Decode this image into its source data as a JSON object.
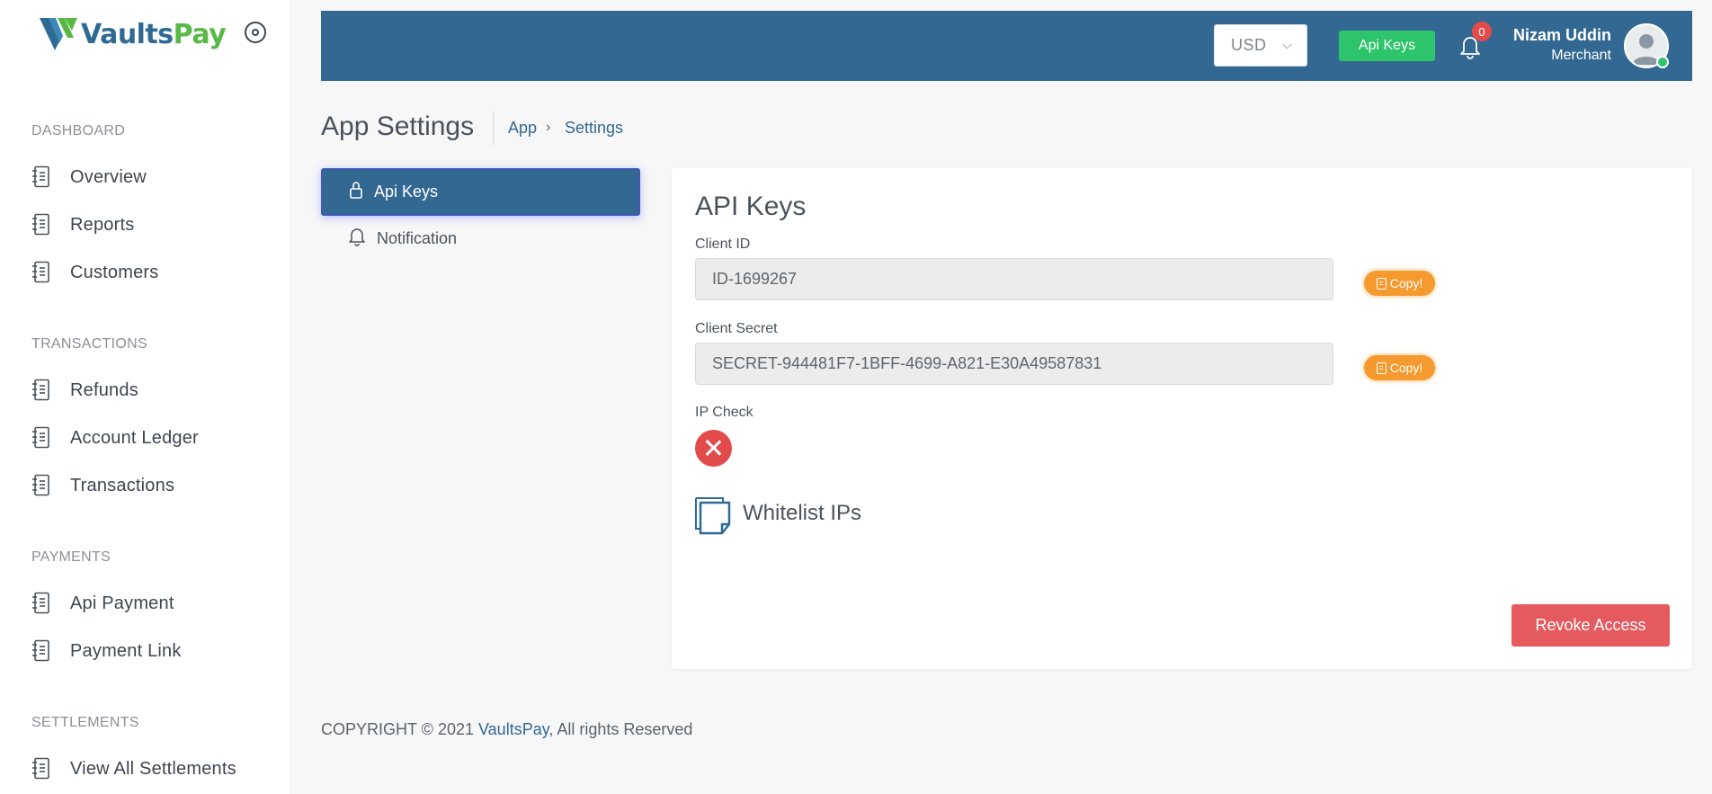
{
  "brand": {
    "name_part1": "Vaults",
    "name_part2": "Pay",
    "logo_icon": "vaultspay-logo",
    "primary_color": "#326891",
    "accent_color": "#58b947"
  },
  "sidebar": {
    "sections": [
      {
        "title": "DASHBOARD",
        "items": [
          {
            "label": "Overview",
            "icon": "document-list-icon"
          },
          {
            "label": "Reports",
            "icon": "document-list-icon"
          },
          {
            "label": "Customers",
            "icon": "document-list-icon"
          }
        ]
      },
      {
        "title": "TRANSACTIONS",
        "items": [
          {
            "label": "Refunds",
            "icon": "document-list-icon"
          },
          {
            "label": "Account Ledger",
            "icon": "document-list-icon"
          },
          {
            "label": "Transactions",
            "icon": "document-list-icon"
          }
        ]
      },
      {
        "title": "PAYMENTS",
        "items": [
          {
            "label": "Api Payment",
            "icon": "document-list-icon"
          },
          {
            "label": "Payment Link",
            "icon": "document-list-icon"
          }
        ]
      },
      {
        "title": "SETTLEMENTS",
        "items": [
          {
            "label": "View All Settlements",
            "icon": "document-list-icon"
          }
        ]
      }
    ]
  },
  "header": {
    "currency": "USD",
    "api_keys_label": "Api Keys",
    "notification_count": "0",
    "user": {
      "name": "Nizam Uddin",
      "role": "Merchant",
      "status_color": "#2ec46b"
    }
  },
  "page": {
    "title": "App Settings",
    "breadcrumb": {
      "app": "App",
      "separator": "›",
      "current": "Settings"
    }
  },
  "settings_nav": {
    "items": [
      {
        "label": "Api Keys",
        "icon": "lock-icon",
        "active": true
      },
      {
        "label": "Notification",
        "icon": "bell-icon",
        "active": false
      }
    ]
  },
  "api_keys": {
    "title": "API Keys",
    "client_id": {
      "label": "Client ID",
      "value": "ID-1699267",
      "copy_label": "Copy!"
    },
    "client_secret": {
      "label": "Client Secret",
      "value": "SECRET-944481F7-1BFF-4699-A821-E30A49587831",
      "copy_label": "Copy!"
    },
    "ip_check": {
      "label": "IP Check",
      "enabled": false,
      "status_color": "#e34b4b"
    },
    "whitelist": {
      "label": "Whitelist IPs"
    },
    "revoke_label": "Revoke Access"
  },
  "footer": {
    "prefix": "COPYRIGHT © 2021 ",
    "brand": "VaultsPay",
    "suffix": ", All rights Reserved"
  }
}
